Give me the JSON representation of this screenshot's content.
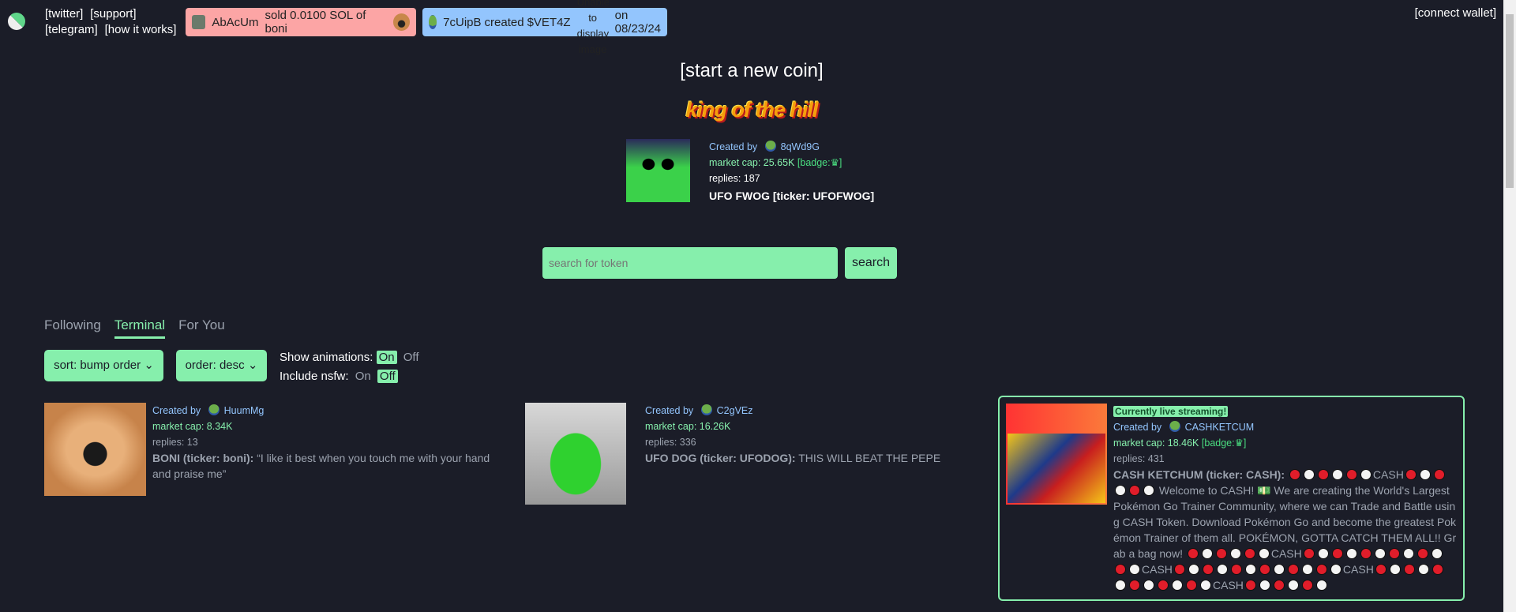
{
  "header": {
    "links": [
      "[twitter]",
      "[support]",
      "[telegram]",
      "[how it works]"
    ],
    "connect_wallet": "[connect wallet]",
    "toast_sell": {
      "user": "AbAcUm",
      "text": "sold 0.0100 SOL of boni",
      "color": "#fca5a5"
    },
    "toast_create": {
      "user": "7cUipB",
      "text": "created",
      "ticker": "$VET4Z",
      "date": "on 08/23/24",
      "alt": "Unable to display image",
      "color": "#93c5fd"
    }
  },
  "start_coin": "[start a new coin]",
  "king": {
    "banner": "king of the hill",
    "created_by": "Created by",
    "creator": "8qWd9G",
    "market_cap": "market cap: 25.65K",
    "badge": "[badge:",
    "badge_end": "]",
    "replies": "replies: 187",
    "title": "UFO FWOG [ticker: UFOFWOG]"
  },
  "search": {
    "placeholder": "search for token",
    "button": "search"
  },
  "tabs": [
    {
      "label": "Following",
      "active": false
    },
    {
      "label": "Terminal",
      "active": true
    },
    {
      "label": "For You",
      "active": false
    }
  ],
  "filters": {
    "sort": "sort: bump order",
    "order": "order: desc",
    "animations_label": "Show animations:",
    "nsfw_label": "Include nsfw:",
    "on": "On",
    "off": "Off",
    "animations": "On",
    "nsfw": "Off"
  },
  "coins": [
    {
      "created_by": "Created by",
      "creator": "HuumMg",
      "market_cap": "market cap: 8.34K",
      "replies": "replies: 13",
      "name": "BONI (ticker: boni):",
      "desc": "“I like it best when you touch me with your hand and praise me”"
    },
    {
      "created_by": "Created by",
      "creator": "C2gVEz",
      "market_cap": "market cap: 16.26K",
      "replies": "replies: 336",
      "name": "UFO DOG (ticker: UFODOG):",
      "desc": "THIS WILL BEAT THE PEPE"
    },
    {
      "live": "Currently live streaming!",
      "created_by": "Created by",
      "creator": "CASHKETCUM",
      "market_cap": "market cap: 18.46K",
      "badge": "[badge:",
      "badge_end": "]",
      "replies": "replies: 431",
      "name": "CASH KETCHUM (ticker: CASH):",
      "desc_parts": [
        "rwrwrw",
        "CASH",
        "rwr",
        "wrw",
        " Welcome to CASH! 💵 We are creating the World's Largest Pokémon Go Trainer Community, where we can Trade and Battle using CASH Token. Download Pokémon Go and become the greatest Pokémon Trainer of them all. POKÉMON, GOTTA CATCH THEM ALL!! Grab a bag now! ",
        "rwrwrw",
        "CASH",
        "rwrwrwrwrwrw",
        "CASH",
        "rwrwrwrwrwrw",
        "CASH",
        "rwrwrwrwrwrw",
        "CASH",
        "rwrwrw"
      ]
    }
  ]
}
